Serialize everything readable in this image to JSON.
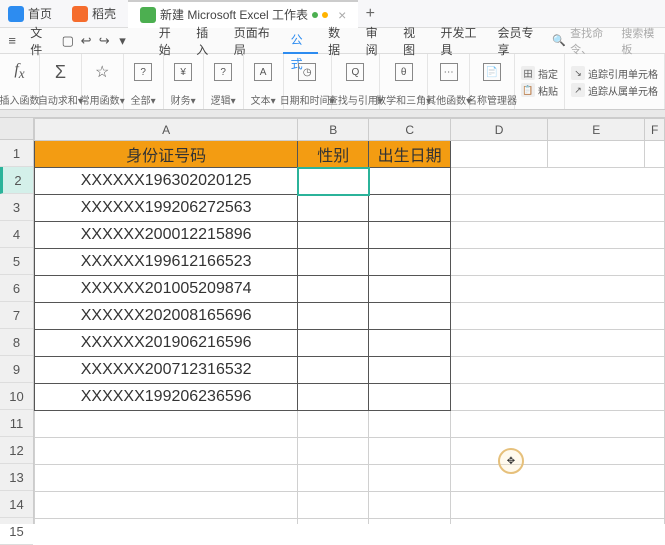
{
  "tabs": {
    "home": "首页",
    "shell": "稻壳",
    "doc": "新建 Microsoft Excel 工作表"
  },
  "menu": {
    "file": "文件",
    "items": [
      "开始",
      "插入",
      "页面布局",
      "公式",
      "数据",
      "审阅",
      "视图",
      "开发工具",
      "会员专享"
    ],
    "active_index": 3,
    "search1": "查找命令、",
    "search2": "搜索模板"
  },
  "ribbon": {
    "g1": "插入函数",
    "g2": "自动求和",
    "g3": "常用函数",
    "g4": "全部",
    "g5": "财务",
    "g6": "逻辑",
    "g7": "文本",
    "g8": "日期和时间",
    "g9": "查找与引用",
    "g10": "数学和三角",
    "g11": "其他函数",
    "g12": "名称管理器",
    "r1": "指定",
    "r2": "粘贴",
    "r3": "追踪引用单元格",
    "r4": "追踪从属单元格"
  },
  "sheet": {
    "cols": [
      "A",
      "B",
      "C",
      "D",
      "E",
      "F"
    ],
    "headers": {
      "a": "身份证号码",
      "b": "性别",
      "c": "出生日期"
    },
    "rows": [
      "XXXXXX196302020125",
      "XXXXXX199206272563",
      "XXXXXX200012215896",
      "XXXXXX199612166523",
      "XXXXXX201005209874",
      "XXXXXX202008165696",
      "XXXXXX201906216596",
      "XXXXXX200712316532",
      "XXXXXX199206236596"
    ],
    "selected_cell": "B2"
  }
}
